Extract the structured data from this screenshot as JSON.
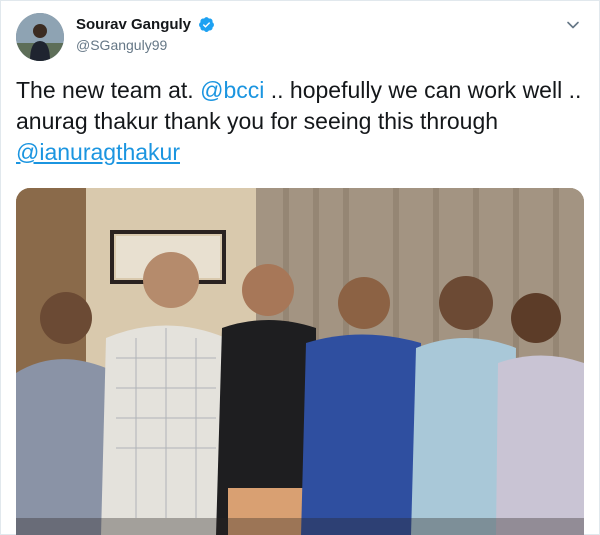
{
  "author": {
    "display_name": "Sourav Ganguly",
    "handle": "@SGanguly99",
    "verified": true,
    "verified_icon": "verified-badge-icon"
  },
  "tweet": {
    "text_part1": "The new team at. ",
    "mention1": "@bcci",
    "text_part2": " .. hopefully we can work well .. anurag thakur thank you for seeing this through ",
    "mention2": "@ianuragthakur"
  },
  "menu": {
    "icon": "chevron-down-icon"
  },
  "colors": {
    "link": "#1b95e0",
    "verified": "#1da1f2",
    "text": "#14171a",
    "secondary": "#657786",
    "border": "#e1e8ed"
  }
}
